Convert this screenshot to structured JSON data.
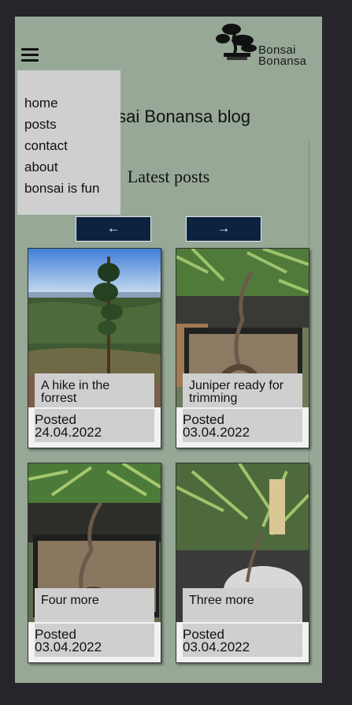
{
  "header": {
    "logo_line1": "Bonsai",
    "logo_line2": "Bonansa"
  },
  "menu": {
    "items": [
      "home",
      "posts",
      "contact",
      "about",
      "bonsai is fun"
    ]
  },
  "main": {
    "blog_title": "Bonsai Bonansa blog",
    "latest_title": "Latest posts",
    "prev_label": "←",
    "next_label": "→",
    "posts": [
      {
        "title": "A hike in the forrest",
        "posted_label": "Posted",
        "date": "24.04.2022"
      },
      {
        "title": "Juniper ready for trimming",
        "posted_label": "Posted",
        "date": "03.04.2022"
      },
      {
        "title": "Four more",
        "posted_label": "Posted",
        "date": "03.04.2022"
      },
      {
        "title": "Three more",
        "posted_label": "Posted",
        "date": "03.04.2022"
      }
    ]
  },
  "colors": {
    "page_bg": "#97a897",
    "outer_bg": "#26252b",
    "button_bg": "#0c2340",
    "menu_bg": "#cfcfcf"
  }
}
